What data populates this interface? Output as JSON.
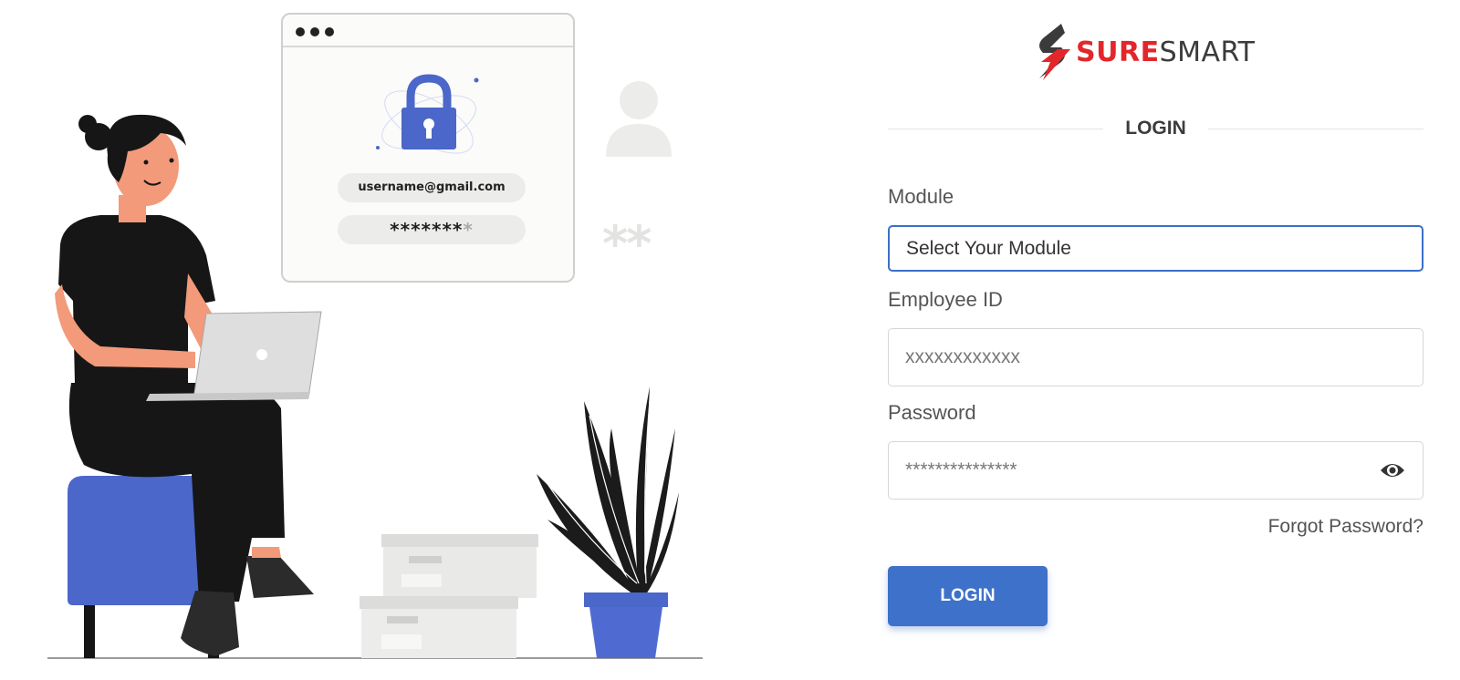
{
  "illustration": {
    "card_username": "username@gmail.com",
    "card_password_dark": "*******",
    "card_password_faded": "*",
    "ghost_stars": "**"
  },
  "brand": {
    "logo_text_red": "SURE",
    "logo_text_dark": "SMART",
    "red": "#e3262b",
    "dark": "#3b3b3b"
  },
  "login": {
    "heading": "LOGIN",
    "module_label": "Module",
    "module_value": "Select Your Module",
    "employee_label": "Employee ID",
    "employee_placeholder": "xxxxxxxxxxxx",
    "password_label": "Password",
    "password_value": "***************",
    "forgot": "Forgot Password?",
    "button": "LOGIN",
    "accent": "#3e71c9"
  },
  "icons": {
    "password_toggle": "eye-icon",
    "lock": "padlock-icon",
    "user": "user-silhouette-icon"
  }
}
